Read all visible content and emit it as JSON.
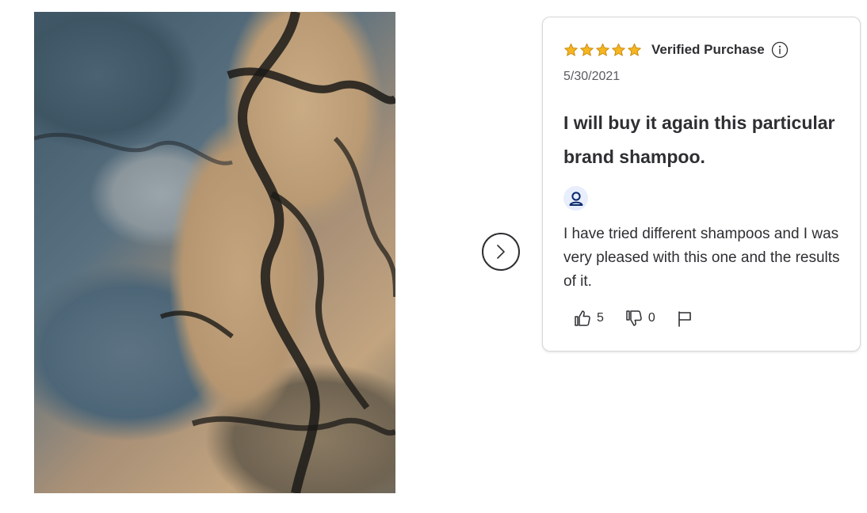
{
  "review": {
    "rating": 5,
    "rating_max": 5,
    "star_color": "#f5b621",
    "verified_label": "Verified Purchase",
    "date": "5/30/2021",
    "title": "I will buy it again this particular brand shampoo.",
    "body": "I have tried different shampoos and I was very pleased with this one and the results of it.",
    "helpful_count": "5",
    "not_helpful_count": "0",
    "icons": {
      "info": "info-icon",
      "avatar": "user-icon",
      "helpful": "thumbs-up-icon",
      "not_helpful": "thumbs-down-icon",
      "report": "flag-icon"
    }
  },
  "carousel": {
    "next_icon": "chevron-right-icon"
  }
}
